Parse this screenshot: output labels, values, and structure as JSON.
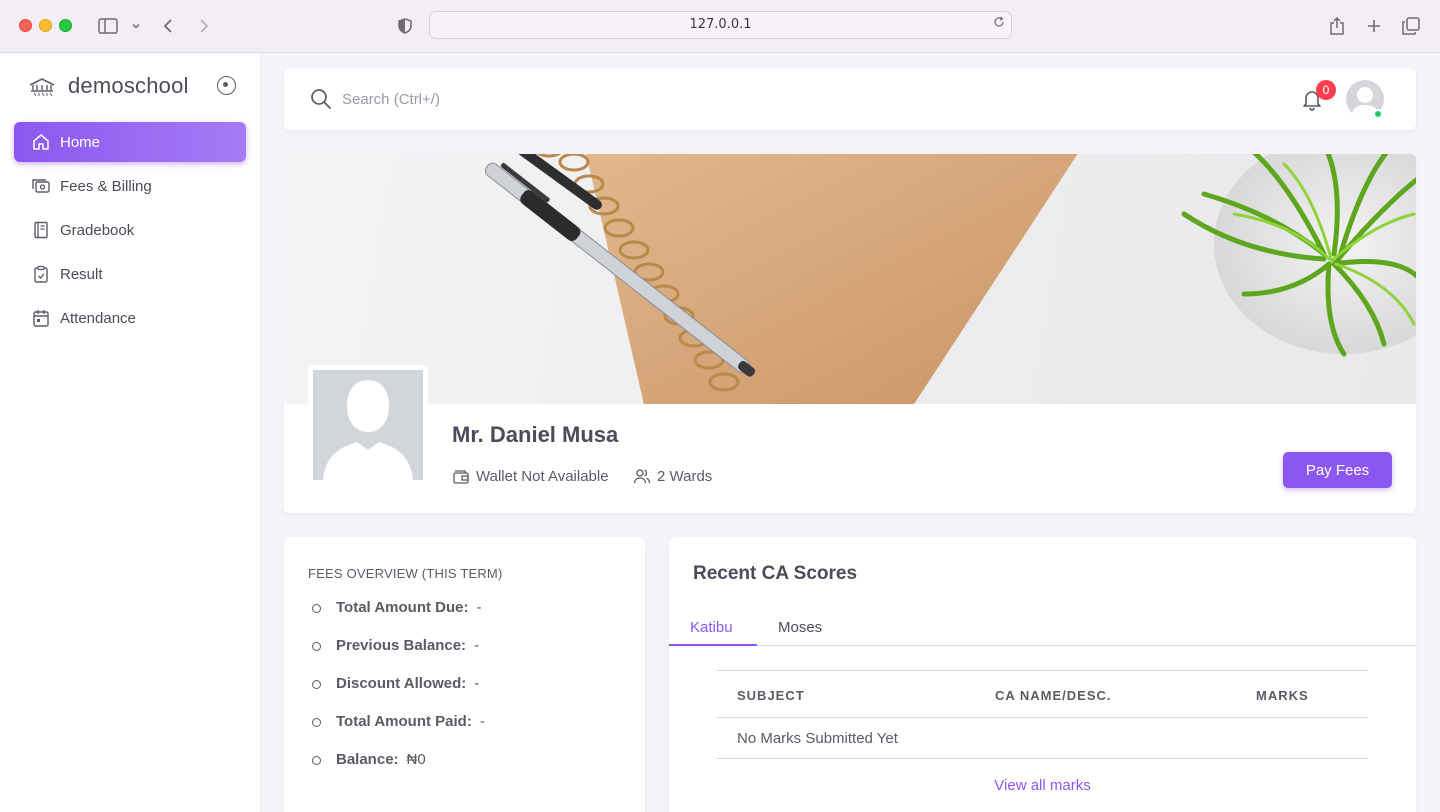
{
  "browser": {
    "url": "127.0.0.1"
  },
  "sidebar": {
    "brand": "demoschool",
    "items": [
      {
        "label": "Home",
        "icon": "home-icon",
        "active": true
      },
      {
        "label": "Fees & Billing",
        "icon": "billing-icon",
        "active": false
      },
      {
        "label": "Gradebook",
        "icon": "gradebook-icon",
        "active": false
      },
      {
        "label": "Result",
        "icon": "clipboard-icon",
        "active": false
      },
      {
        "label": "Attendance",
        "icon": "calendar-icon",
        "active": false
      }
    ]
  },
  "topbar": {
    "search_placeholder": "Search (Ctrl+/)",
    "notification_count": "0"
  },
  "profile": {
    "name": "Mr. Daniel Musa",
    "wallet": "Wallet Not Available",
    "wards": "2 Wards",
    "pay_button": "Pay Fees"
  },
  "fees": {
    "title": "FEES OVERVIEW (THIS TERM)",
    "items": [
      {
        "label": "Total Amount Due:",
        "value": "-"
      },
      {
        "label": "Previous Balance:",
        "value": "-"
      },
      {
        "label": "Discount Allowed:",
        "value": "-"
      },
      {
        "label": "Total Amount Paid:",
        "value": "-"
      },
      {
        "label": "Balance:",
        "value": "₦0"
      }
    ]
  },
  "ca_scores": {
    "title": "Recent CA Scores",
    "tabs": [
      "Katibu",
      "Moses"
    ],
    "active_tab": "Katibu",
    "columns": [
      "SUBJECT",
      "CA NAME/DESC.",
      "MARKS"
    ],
    "empty_message": "No Marks Submitted Yet",
    "view_all": "View all marks"
  },
  "colors": {
    "accent": "#8c57f0",
    "badge": "#ff3e4d",
    "online": "#28c76f"
  }
}
